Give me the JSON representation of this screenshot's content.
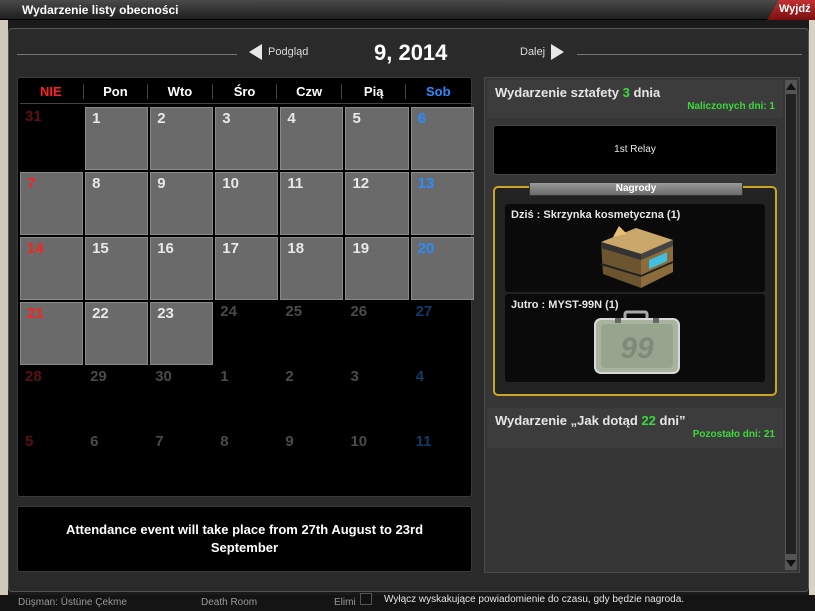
{
  "window": {
    "title": "Wydarzenie listy obecności",
    "exit_label": "Wyjdź"
  },
  "nav": {
    "prev_label": "Podgląd",
    "next_label": "Dalej",
    "month": "9, 2014"
  },
  "weekdays": [
    "NIE",
    "Pon",
    "Wto",
    "Śro",
    "Czw",
    "Pią",
    "Sob"
  ],
  "calendar_days": [
    {
      "d": "31",
      "state": "dim"
    },
    {
      "d": "1",
      "state": "active"
    },
    {
      "d": "2",
      "state": "active"
    },
    {
      "d": "3",
      "state": "active"
    },
    {
      "d": "4",
      "state": "active"
    },
    {
      "d": "5",
      "state": "active"
    },
    {
      "d": "6",
      "state": "active"
    },
    {
      "d": "7",
      "state": "active"
    },
    {
      "d": "8",
      "state": "active"
    },
    {
      "d": "9",
      "state": "active"
    },
    {
      "d": "10",
      "state": "active"
    },
    {
      "d": "11",
      "state": "active"
    },
    {
      "d": "12",
      "state": "active"
    },
    {
      "d": "13",
      "state": "active"
    },
    {
      "d": "14",
      "state": "active"
    },
    {
      "d": "15",
      "state": "active"
    },
    {
      "d": "16",
      "state": "active"
    },
    {
      "d": "17",
      "state": "active"
    },
    {
      "d": "18",
      "state": "active"
    },
    {
      "d": "19",
      "state": "active"
    },
    {
      "d": "20",
      "state": "active"
    },
    {
      "d": "21",
      "state": "active"
    },
    {
      "d": "22",
      "state": "active"
    },
    {
      "d": "23",
      "state": "active"
    },
    {
      "d": "24",
      "state": "dim"
    },
    {
      "d": "25",
      "state": "dim"
    },
    {
      "d": "26",
      "state": "dim"
    },
    {
      "d": "27",
      "state": "dim"
    },
    {
      "d": "28",
      "state": "dim"
    },
    {
      "d": "29",
      "state": "dim"
    },
    {
      "d": "30",
      "state": "dim"
    },
    {
      "d": "1",
      "state": "dim"
    },
    {
      "d": "2",
      "state": "dim"
    },
    {
      "d": "3",
      "state": "dim"
    },
    {
      "d": "4",
      "state": "dim"
    },
    {
      "d": "5",
      "state": "dim"
    },
    {
      "d": "6",
      "state": "dim"
    },
    {
      "d": "7",
      "state": "dim"
    },
    {
      "d": "8",
      "state": "dim"
    },
    {
      "d": "9",
      "state": "dim"
    },
    {
      "d": "10",
      "state": "dim"
    },
    {
      "d": "11",
      "state": "dim"
    }
  ],
  "info_text": "Attendance event will take place from 27th August to 23rd September",
  "relay_event": {
    "title_prefix": "Wydarzenie sztafety",
    "days": "3",
    "title_suffix": "dnia",
    "subtitle": "Naliczonych dni: 1",
    "box_label": "1st Relay"
  },
  "rewards": {
    "label": "Nagrody",
    "today": "Dziś : Skrzynka kosmetyczna (1)",
    "tomorrow": "Jutro : MYST-99N (1)"
  },
  "howto_event": {
    "title_prefix": "Wydarzenie „Jak dotąd",
    "days": "22",
    "title_suffix": "dni”",
    "subtitle": "Pozostało dni: 21"
  },
  "popup_checkbox_label": "Wyłącz wyskakujące powiadomienie do czasu, gdy będzie nagroda.",
  "background_texts": {
    "left": "Düşman: Üstüne Çekme",
    "mid": "Death Room",
    "right": "Elimi"
  },
  "colors": {
    "sunday": "#ff2020",
    "saturday": "#2a8cff",
    "highlight_green": "#3dd93d",
    "reward_border": "#c9a820"
  }
}
